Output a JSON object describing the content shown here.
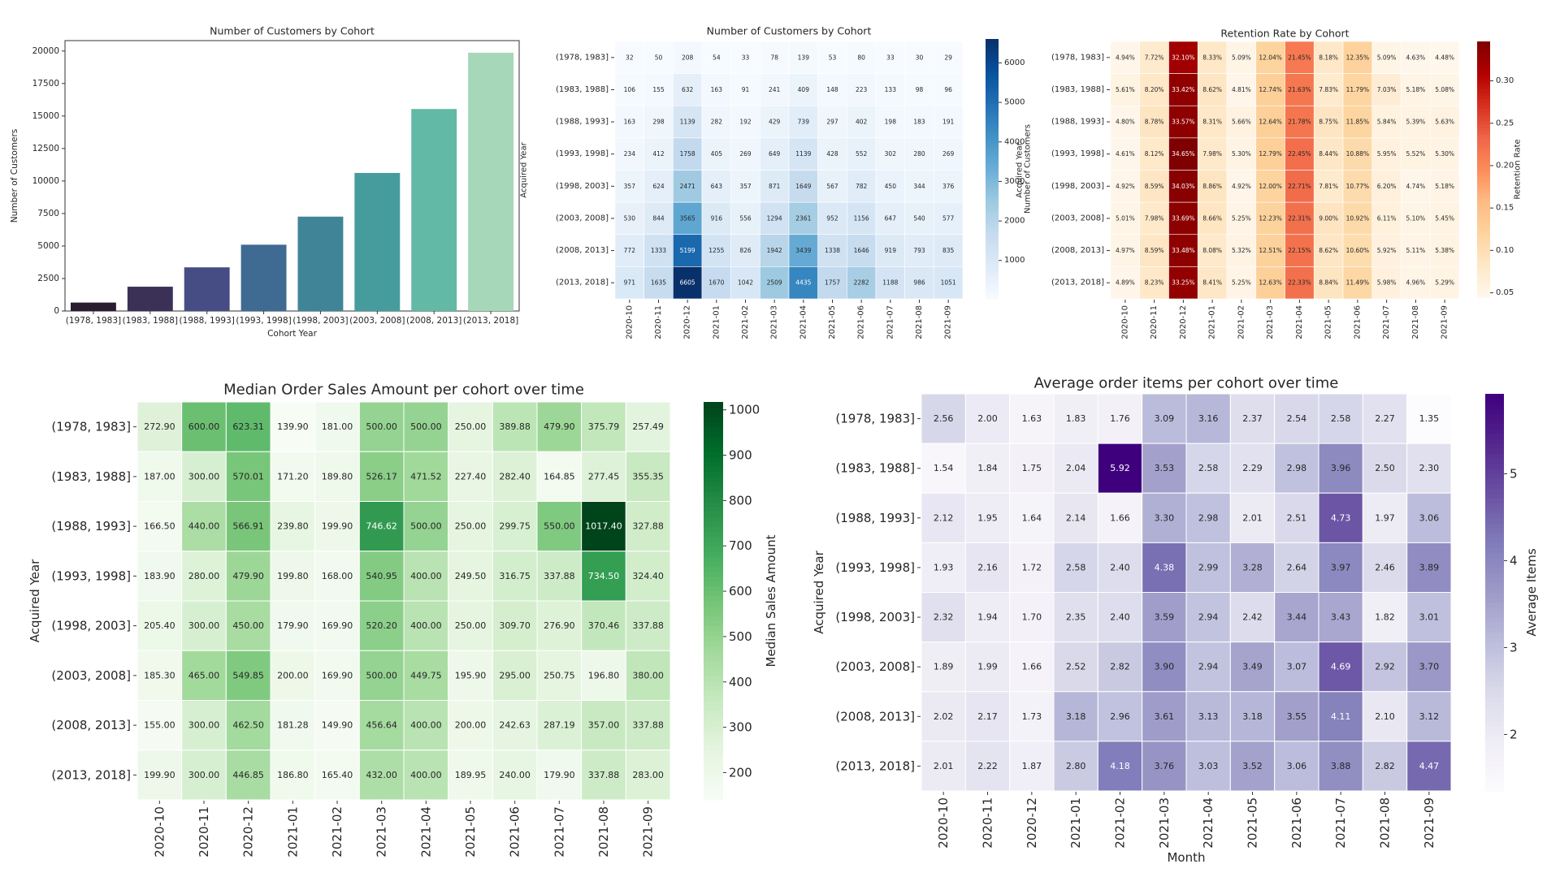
{
  "chart_data": [
    {
      "id": "bar",
      "type": "bar",
      "title": "Number of Customers by Cohort",
      "xlabel": "Cohort Year",
      "ylabel": "Number of Customers",
      "categories": [
        "(1978, 1983]",
        "(1983, 1988]",
        "(1988, 1993]",
        "(1993, 1998]",
        "(1998, 2003]",
        "(2003, 2008]",
        "(2008, 2013]",
        "(2013, 2018]"
      ],
      "values": [
        650,
        1870,
        3360,
        5100,
        7260,
        10620,
        15540,
        19870
      ],
      "colors": [
        "#2a1d30",
        "#3b3157",
        "#464d84",
        "#3f6a92",
        "#3f8597",
        "#469c9c",
        "#62b9a5",
        "#a5d7b8"
      ],
      "ylim": [
        0,
        20800
      ],
      "yticks": [
        0,
        2500,
        5000,
        7500,
        10000,
        12500,
        15000,
        17500,
        20000
      ],
      "grid": false
    },
    {
      "id": "customers",
      "type": "heatmap",
      "title": "Number of Customers by Cohort",
      "xlabel": "",
      "ylabel": "Acquired Year",
      "colorbar_label": "Number of Customers",
      "colormap": "Blues",
      "vmin": 29,
      "vmax": 6605,
      "colorbar_ticks": [
        1000,
        2000,
        3000,
        4000,
        5000,
        6000
      ],
      "format": "int",
      "rows": [
        "(1978, 1983]",
        "(1983, 1988]",
        "(1988, 1993]",
        "(1993, 1998]",
        "(1998, 2003]",
        "(2003, 2008]",
        "(2008, 2013]",
        "(2013, 2018]"
      ],
      "cols": [
        "2020-10",
        "2020-11",
        "2020-12",
        "2021-01",
        "2021-02",
        "2021-03",
        "2021-04",
        "2021-05",
        "2021-06",
        "2021-07",
        "2021-08",
        "2021-09"
      ],
      "values": [
        [
          32,
          50,
          208,
          54,
          33,
          78,
          139,
          53,
          80,
          33,
          30,
          29
        ],
        [
          106,
          155,
          632,
          163,
          91,
          241,
          409,
          148,
          223,
          133,
          98,
          96
        ],
        [
          163,
          298,
          1139,
          282,
          192,
          429,
          739,
          297,
          402,
          198,
          183,
          191
        ],
        [
          234,
          412,
          1758,
          405,
          269,
          649,
          1139,
          428,
          552,
          302,
          280,
          269
        ],
        [
          357,
          624,
          2471,
          643,
          357,
          871,
          1649,
          567,
          782,
          450,
          344,
          376
        ],
        [
          530,
          844,
          3565,
          916,
          556,
          1294,
          2361,
          952,
          1156,
          647,
          540,
          577
        ],
        [
          772,
          1333,
          5199,
          1255,
          826,
          1942,
          3439,
          1338,
          1646,
          919,
          793,
          835
        ],
        [
          971,
          1635,
          6605,
          1670,
          1042,
          2509,
          4435,
          1757,
          2282,
          1188,
          986,
          1051
        ]
      ]
    },
    {
      "id": "retention",
      "type": "heatmap",
      "title": "Retention Rate by Cohort",
      "xlabel": "",
      "ylabel": "Acquired Year",
      "colorbar_label": "Retention Rate",
      "colormap": "OrRd",
      "vmin": 0.0448,
      "vmax": 0.3465,
      "colorbar_ticks": [
        0.05,
        0.1,
        0.15,
        0.2,
        0.25,
        0.3
      ],
      "format": "pct",
      "rows": [
        "(1978, 1983]",
        "(1983, 1988]",
        "(1988, 1993]",
        "(1993, 1998]",
        "(1998, 2003]",
        "(2003, 2008]",
        "(2008, 2013]",
        "(2013, 2018]"
      ],
      "cols": [
        "2020-10",
        "2020-11",
        "2020-12",
        "2021-01",
        "2021-02",
        "2021-03",
        "2021-04",
        "2021-05",
        "2021-06",
        "2021-07",
        "2021-08",
        "2021-09"
      ],
      "values": [
        [
          0.0494,
          0.0772,
          0.321,
          0.0833,
          0.0509,
          0.1204,
          0.2145,
          0.0818,
          0.1235,
          0.0509,
          0.0463,
          0.0448
        ],
        [
          0.0561,
          0.082,
          0.3342,
          0.0862,
          0.0481,
          0.1274,
          0.2163,
          0.0783,
          0.1179,
          0.0703,
          0.0518,
          0.0508
        ],
        [
          0.048,
          0.0878,
          0.3357,
          0.0831,
          0.0566,
          0.1264,
          0.2178,
          0.0875,
          0.1185,
          0.0584,
          0.0539,
          0.0563
        ],
        [
          0.0461,
          0.0812,
          0.3465,
          0.0798,
          0.053,
          0.1279,
          0.2245,
          0.0844,
          0.1088,
          0.0595,
          0.0552,
          0.053
        ],
        [
          0.0492,
          0.0859,
          0.3403,
          0.0886,
          0.0492,
          0.12,
          0.2271,
          0.0781,
          0.1077,
          0.062,
          0.0474,
          0.0518
        ],
        [
          0.0501,
          0.0798,
          0.3369,
          0.0866,
          0.0525,
          0.1223,
          0.2231,
          0.09,
          0.1092,
          0.0611,
          0.051,
          0.0545
        ],
        [
          0.0497,
          0.0859,
          0.3348,
          0.0808,
          0.0532,
          0.1251,
          0.2215,
          0.0862,
          0.106,
          0.0592,
          0.0511,
          0.0538
        ],
        [
          0.0489,
          0.0823,
          0.3325,
          0.0841,
          0.0525,
          0.1263,
          0.2233,
          0.0884,
          0.1149,
          0.0598,
          0.0496,
          0.0529
        ]
      ]
    },
    {
      "id": "median",
      "type": "heatmap",
      "title": "Median Order Sales Amount per cohort over time",
      "xlabel": "",
      "ylabel": "Acquired Year",
      "colorbar_label": "Median Sales Amount",
      "colormap": "Greens",
      "vmin": 139.9,
      "vmax": 1017.4,
      "colorbar_ticks": [
        200,
        300,
        400,
        500,
        600,
        700,
        800,
        900,
        1000
      ],
      "format": "2f",
      "rows": [
        "(1978, 1983]",
        "(1983, 1988]",
        "(1988, 1993]",
        "(1993, 1998]",
        "(1998, 2003]",
        "(2003, 2008]",
        "(2008, 2013]",
        "(2013, 2018]"
      ],
      "cols": [
        "2020-10",
        "2020-11",
        "2020-12",
        "2021-01",
        "2021-02",
        "2021-03",
        "2021-04",
        "2021-05",
        "2021-06",
        "2021-07",
        "2021-08",
        "2021-09"
      ],
      "values": [
        [
          272.9,
          600.0,
          623.31,
          139.9,
          181.0,
          500.0,
          500.0,
          250.0,
          389.88,
          479.9,
          375.79,
          257.49
        ],
        [
          187.0,
          300.0,
          570.01,
          171.2,
          189.8,
          526.17,
          471.52,
          227.4,
          282.4,
          164.85,
          277.45,
          355.35
        ],
        [
          166.5,
          440.0,
          566.91,
          239.8,
          199.9,
          746.62,
          500.0,
          250.0,
          299.75,
          550.0,
          1017.4,
          327.88
        ],
        [
          183.9,
          280.0,
          479.9,
          199.8,
          168.0,
          540.95,
          400.0,
          249.5,
          316.75,
          337.88,
          734.5,
          324.4
        ],
        [
          205.4,
          300.0,
          450.0,
          179.9,
          169.9,
          520.2,
          400.0,
          250.0,
          309.7,
          276.9,
          370.46,
          337.88
        ],
        [
          185.3,
          465.0,
          549.85,
          200.0,
          169.9,
          500.0,
          449.75,
          195.9,
          295.0,
          250.75,
          196.8,
          380.0
        ],
        [
          155.0,
          300.0,
          462.5,
          181.28,
          149.9,
          456.64,
          400.0,
          200.0,
          242.63,
          287.19,
          357.0,
          337.88
        ],
        [
          199.9,
          300.0,
          446.85,
          186.8,
          165.4,
          432.0,
          400.0,
          189.95,
          240.0,
          179.9,
          337.88,
          283.0
        ]
      ]
    },
    {
      "id": "items",
      "type": "heatmap",
      "title": "Average order items per cohort over time",
      "xlabel": "Month",
      "ylabel": "Acquired Year",
      "colorbar_label": "Average Items",
      "colormap": "Purples",
      "vmin": 1.35,
      "vmax": 5.92,
      "colorbar_ticks": [
        2,
        3,
        4,
        5
      ],
      "format": "2f",
      "rows": [
        "(1978, 1983]",
        "(1983, 1988]",
        "(1988, 1993]",
        "(1993, 1998]",
        "(1998, 2003]",
        "(2003, 2008]",
        "(2008, 2013]",
        "(2013, 2018]"
      ],
      "cols": [
        "2020-10",
        "2020-11",
        "2020-12",
        "2021-01",
        "2021-02",
        "2021-03",
        "2021-04",
        "2021-05",
        "2021-06",
        "2021-07",
        "2021-08",
        "2021-09"
      ],
      "values": [
        [
          2.56,
          2.0,
          1.63,
          1.83,
          1.76,
          3.09,
          3.16,
          2.37,
          2.54,
          2.58,
          2.27,
          1.35
        ],
        [
          1.54,
          1.84,
          1.75,
          2.04,
          5.92,
          3.53,
          2.58,
          2.29,
          2.98,
          3.96,
          2.5,
          2.3
        ],
        [
          2.12,
          1.95,
          1.64,
          2.14,
          1.66,
          3.3,
          2.98,
          2.01,
          2.51,
          4.73,
          1.97,
          3.06
        ],
        [
          1.93,
          2.16,
          1.72,
          2.58,
          2.4,
          4.38,
          2.99,
          3.28,
          2.64,
          3.97,
          2.46,
          3.89
        ],
        [
          2.32,
          1.94,
          1.7,
          2.35,
          2.4,
          3.59,
          2.94,
          2.42,
          3.44,
          3.43,
          1.82,
          3.01
        ],
        [
          1.89,
          1.99,
          1.66,
          2.52,
          2.82,
          3.9,
          2.94,
          3.49,
          3.07,
          4.69,
          2.92,
          3.7
        ],
        [
          2.02,
          2.17,
          1.73,
          3.18,
          2.96,
          3.61,
          3.13,
          3.18,
          3.55,
          4.11,
          2.1,
          3.12
        ],
        [
          2.01,
          2.22,
          1.87,
          2.8,
          4.18,
          3.76,
          3.03,
          3.52,
          3.06,
          3.88,
          2.82,
          4.47
        ]
      ]
    }
  ]
}
